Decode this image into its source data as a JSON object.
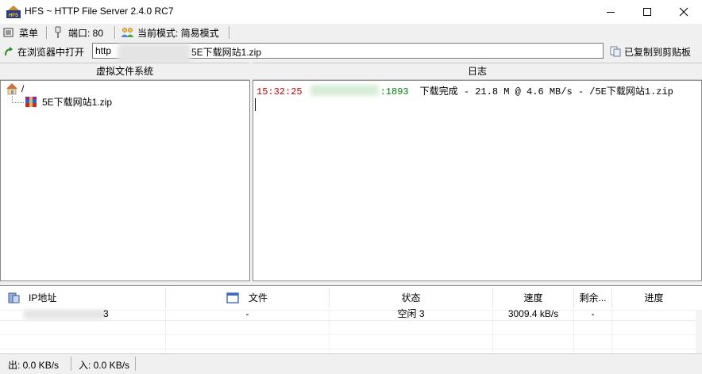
{
  "window": {
    "title": "HFS ~ HTTP File Server 2.4.0 RC7",
    "app_icon_text": "HFS",
    "controls": [
      "minimize",
      "maximize",
      "close"
    ]
  },
  "toolbar": {
    "menu_label": "菜单",
    "port_label": "端口: 80",
    "mode_label": "当前模式: 简易模式"
  },
  "urlbar": {
    "open_in_browser_label": "在浏览器中打开",
    "url_prefix": "http",
    "url_suffix": "5E下载网站1.zip",
    "copied_label": "已复制到剪贴板"
  },
  "vfs": {
    "header": "虚拟文件系统",
    "root_label": "/",
    "items": [
      {
        "name": "5E下载网站1.zip",
        "icon": "rar-archive-icon"
      }
    ]
  },
  "log": {
    "header": "日志",
    "entries": [
      {
        "time": "15:32:25",
        "port": ":1893",
        "message": "下载完成 - 21.8 M @ 4.6 MB/s - /5E下载网站1.zip"
      }
    ]
  },
  "connections": {
    "columns": [
      "IP地址",
      "文件",
      "状态",
      "速度",
      "剩余...",
      "进度"
    ],
    "rows": [
      {
        "ip_visible": "3",
        "file": "-",
        "status": "空闲 3",
        "speed": "3009.4 kB/s",
        "remaining": "-",
        "progress": ""
      }
    ]
  },
  "statusbar": {
    "out_label": "出: 0.0 KB/s",
    "in_label": "入: 0.0 KB/s"
  },
  "colors": {
    "log_time": "#c00000",
    "log_port": "#008000",
    "window_bg": "#f0f0f0"
  }
}
